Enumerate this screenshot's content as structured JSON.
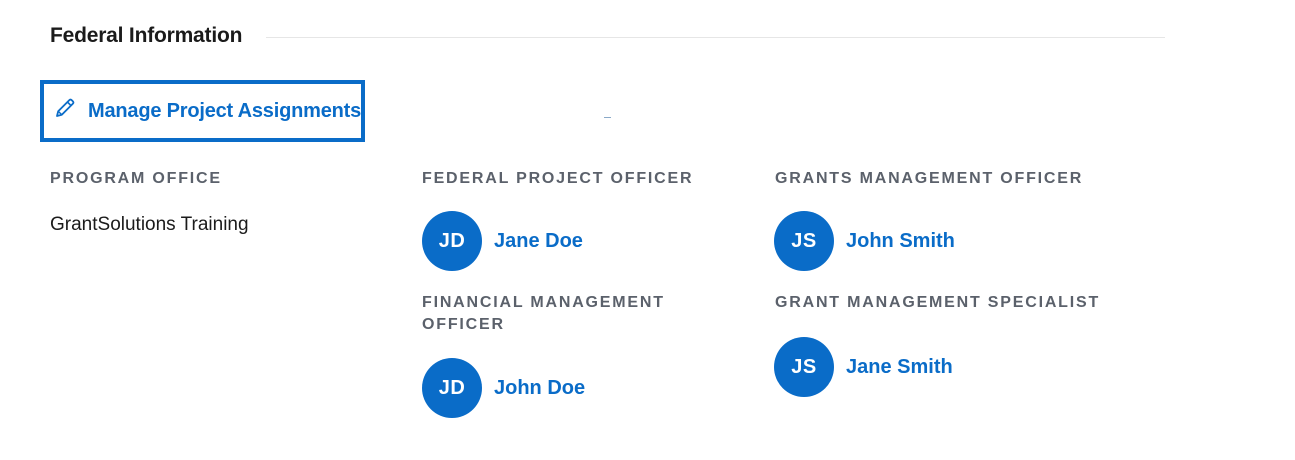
{
  "section": {
    "title": "Federal Information"
  },
  "manage_button": {
    "label": "Manage Project Assignments",
    "icon": "pencil-icon"
  },
  "program_office": {
    "label": "PROGRAM OFFICE",
    "value": "GrantSolutions Training"
  },
  "roles": [
    {
      "label": "FEDERAL PROJECT OFFICER",
      "initials": "JD",
      "name": "Jane Doe"
    },
    {
      "label": "GRANTS MANAGEMENT OFFICER",
      "initials": "JS",
      "name": "John Smith"
    },
    {
      "label": "FINANCIAL MANAGEMENT OFFICER",
      "initials": "JD",
      "name": "John Doe"
    },
    {
      "label": "GRANT MANAGEMENT SPECIALIST",
      "initials": "JS",
      "name": "Jane Smith"
    }
  ],
  "colors": {
    "accent": "#0a6cc8",
    "label_gray": "#5b616b",
    "text": "#1b1b1b"
  }
}
